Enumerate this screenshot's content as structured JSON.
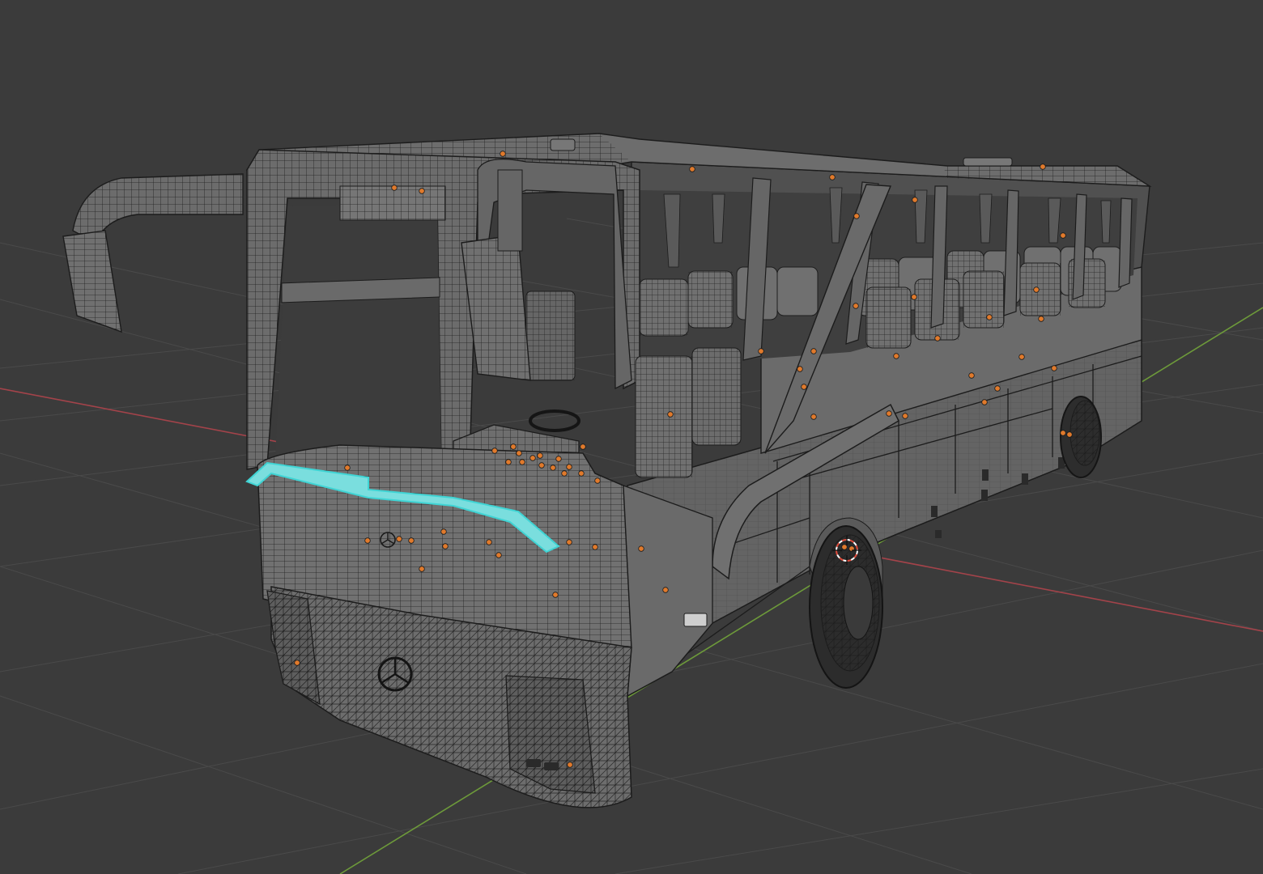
{
  "viewport": {
    "shading": "wireframe-over-solid",
    "background_color": "#3b3b3b",
    "grid_color": "#4a4a4a",
    "x_axis_color": "#a3434a",
    "y_axis_color": "#6d9a3a"
  },
  "scene": {
    "object": "coach bus mesh",
    "object_color": "#6a6a6a",
    "wire_color": "#1c1c1c",
    "selected_edge_color": "#3fd4d4",
    "object_origin_color": "#e07a2c",
    "origin_count_visible": 64
  },
  "cursor_3d": {
    "icon": "3d-cursor-icon",
    "color_a": "#e04a3a",
    "color_b": "#ffffff"
  }
}
